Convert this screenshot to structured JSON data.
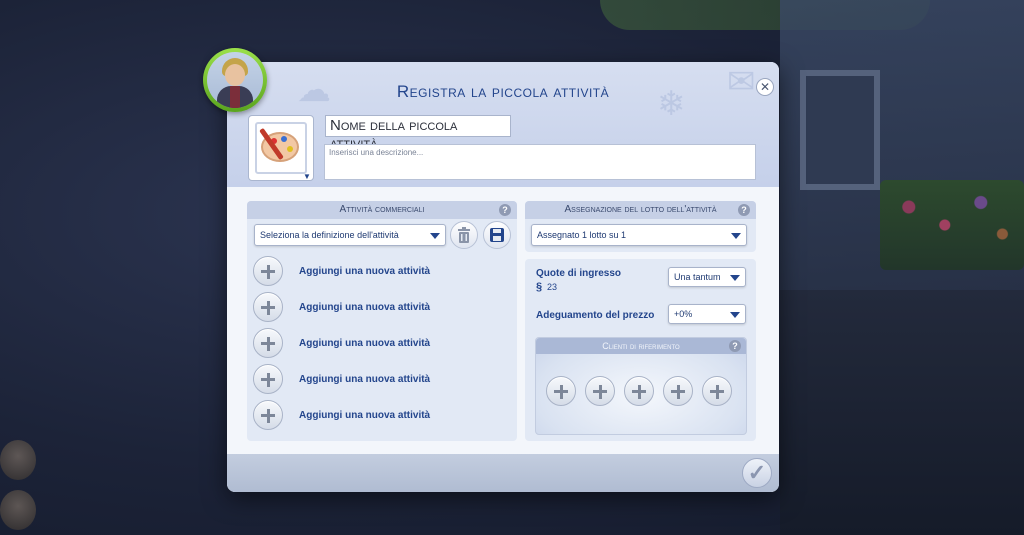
{
  "dialog": {
    "title": "Registra la piccola attività",
    "close_icon": "close-icon",
    "name_value": "Nome della piccola attività",
    "description_placeholder": "Inserisci una descrizione..."
  },
  "activities_panel": {
    "header": "Attività commerciali",
    "help": "?",
    "definition_dropdown": "Seleziona la definizione dell'attività",
    "add_items": [
      "Aggiungi una nuova attività",
      "Aggiungi una nuova attività",
      "Aggiungi una nuova attività",
      "Aggiungi una nuova attività",
      "Aggiungi una nuova attività"
    ]
  },
  "lot_panel": {
    "header": "Assegnazione del lotto dell'attività",
    "help": "?",
    "lot_dropdown": "Assegnato 1 lotto su 1"
  },
  "pricing": {
    "entry_fee_label": "Quote di ingresso",
    "entry_fee_currency": "§",
    "entry_fee_value": "23",
    "entry_fee_dropdown": "Una tantum",
    "price_adjust_label": "Adeguamento del prezzo",
    "price_adjust_dropdown": "+0%"
  },
  "clients": {
    "header": "Clienti di riferimento",
    "help": "?",
    "slots": 5
  },
  "colors": {
    "accent": "#23458c",
    "portrait_ring": "#7ac434"
  }
}
